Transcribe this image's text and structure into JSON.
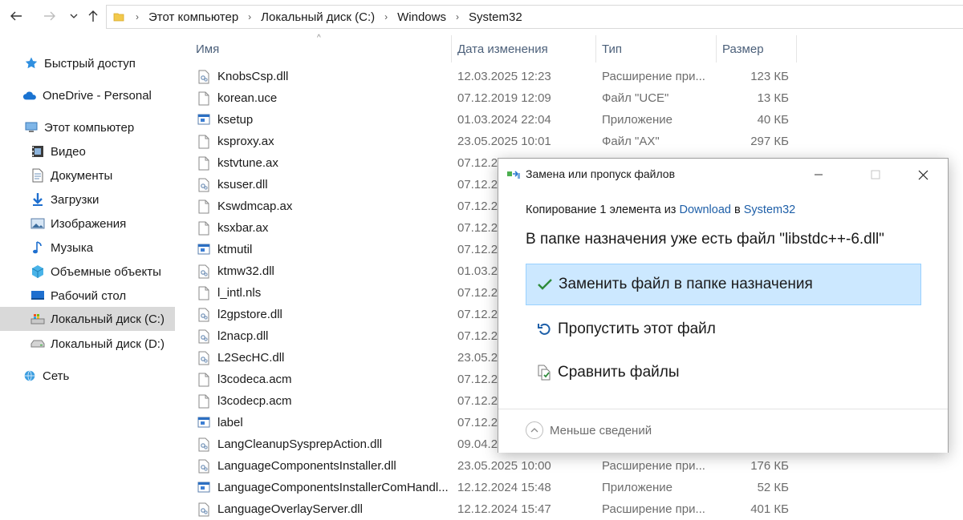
{
  "address_bar": {
    "breadcrumbs": [
      "Этот компьютер",
      "Локальный диск (C:)",
      "Windows",
      "System32"
    ]
  },
  "sidebar": {
    "items": [
      {
        "label": "Быстрый доступ",
        "icon": "star-icon"
      },
      {
        "label": "OneDrive - Personal",
        "icon": "cloud-icon"
      },
      {
        "label": "Этот компьютер",
        "icon": "computer-icon"
      },
      {
        "label": "Видео",
        "icon": "video-icon"
      },
      {
        "label": "Документы",
        "icon": "document-icon"
      },
      {
        "label": "Загрузки",
        "icon": "download-icon"
      },
      {
        "label": "Изображения",
        "icon": "picture-icon"
      },
      {
        "label": "Музыка",
        "icon": "music-icon"
      },
      {
        "label": "Объемные объекты",
        "icon": "cube-icon"
      },
      {
        "label": "Рабочий стол",
        "icon": "desktop-icon"
      },
      {
        "label": "Локальный диск (C:)",
        "icon": "drive-c-icon"
      },
      {
        "label": "Локальный диск (D:)",
        "icon": "drive-icon"
      },
      {
        "label": "Сеть",
        "icon": "network-icon"
      }
    ]
  },
  "columns": {
    "name": "Имя",
    "date": "Дата изменения",
    "type": "Тип",
    "size": "Размер"
  },
  "files": [
    {
      "name": "KnobsCsp.dll",
      "date": "12.03.2025 12:23",
      "type": "Расширение при...",
      "size": "123 КБ",
      "kind": "dll"
    },
    {
      "name": "korean.uce",
      "date": "07.12.2019 12:09",
      "type": "Файл \"UCE\"",
      "size": "13 КБ",
      "kind": "file"
    },
    {
      "name": "ksetup",
      "date": "01.03.2024 22:04",
      "type": "Приложение",
      "size": "40 КБ",
      "kind": "exe"
    },
    {
      "name": "ksproxy.ax",
      "date": "23.05.2025 10:01",
      "type": "Файл \"AX\"",
      "size": "297 КБ",
      "kind": "file"
    },
    {
      "name": "kstvtune.ax",
      "date": "07.12.2",
      "type": "",
      "size": "",
      "kind": "file"
    },
    {
      "name": "ksuser.dll",
      "date": "07.12.2",
      "type": "",
      "size": "",
      "kind": "dll"
    },
    {
      "name": "Kswdmcap.ax",
      "date": "07.12.2",
      "type": "",
      "size": "",
      "kind": "file"
    },
    {
      "name": "ksxbar.ax",
      "date": "07.12.2",
      "type": "",
      "size": "",
      "kind": "file"
    },
    {
      "name": "ktmutil",
      "date": "07.12.2",
      "type": "",
      "size": "",
      "kind": "exe"
    },
    {
      "name": "ktmw32.dll",
      "date": "01.03.2",
      "type": "",
      "size": "",
      "kind": "dll"
    },
    {
      "name": "l_intl.nls",
      "date": "07.12.2",
      "type": "",
      "size": "",
      "kind": "file"
    },
    {
      "name": "l2gpstore.dll",
      "date": "07.12.2",
      "type": "",
      "size": "",
      "kind": "dll"
    },
    {
      "name": "l2nacp.dll",
      "date": "07.12.2",
      "type": "",
      "size": "",
      "kind": "dll"
    },
    {
      "name": "L2SecHC.dll",
      "date": "23.05.2",
      "type": "",
      "size": "",
      "kind": "dll"
    },
    {
      "name": "l3codeca.acm",
      "date": "07.12.2",
      "type": "",
      "size": "",
      "kind": "file"
    },
    {
      "name": "l3codecp.acm",
      "date": "07.12.2",
      "type": "",
      "size": "",
      "kind": "file"
    },
    {
      "name": "label",
      "date": "07.12.2",
      "type": "",
      "size": "",
      "kind": "exe"
    },
    {
      "name": "LangCleanupSysprepAction.dll",
      "date": "09.04.2",
      "type": "",
      "size": "",
      "kind": "dll"
    },
    {
      "name": "LanguageComponentsInstaller.dll",
      "date": "23.05.2025 10:00",
      "type": "Расширение при...",
      "size": "176 КБ",
      "kind": "dll"
    },
    {
      "name": "LanguageComponentsInstallerComHandl...",
      "date": "12.12.2024 15:48",
      "type": "Приложение",
      "size": "52 КБ",
      "kind": "exe"
    },
    {
      "name": "LanguageOverlayServer.dll",
      "date": "12.12.2024 15:47",
      "type": "Расширение при...",
      "size": "401 КБ",
      "kind": "dll"
    }
  ],
  "dialog": {
    "title": "Замена или пропуск файлов",
    "copy_prefix": "Копирование 1 элемента из ",
    "copy_from": "Download",
    "copy_mid": " в ",
    "copy_to": "System32",
    "heading": "В папке назначения уже есть файл \"libstdc++-6.dll\"",
    "options": [
      {
        "label": "Заменить файл в папке назначения",
        "icon": "checkmark-icon"
      },
      {
        "label": "Пропустить этот файл",
        "icon": "skip-undo-icon"
      },
      {
        "label": "Сравнить файлы",
        "icon": "compare-icon"
      }
    ],
    "more_label": "Меньше сведений"
  },
  "colors": {
    "accent": "#0078d7",
    "selection": "#cce8ff",
    "link": "#1e5fa8"
  }
}
